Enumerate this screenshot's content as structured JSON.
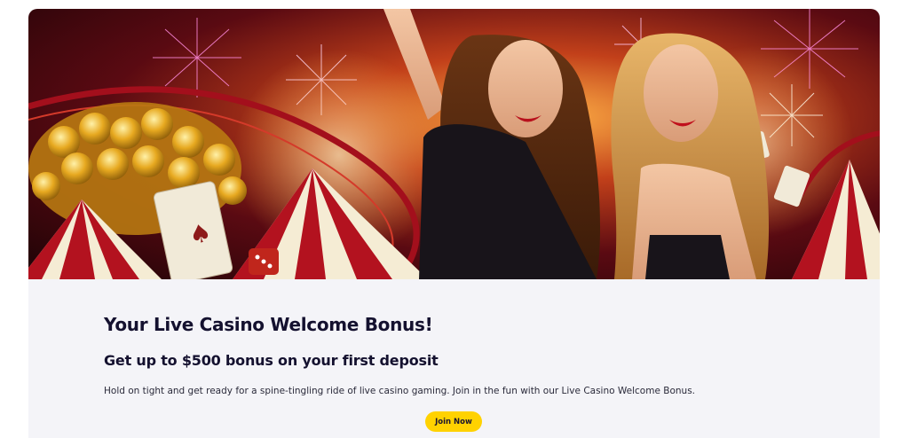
{
  "hero": {
    "image_alt": "Two women celebrating with fireworks, circus tents, gold coins and playing cards",
    "icons": [
      "fireworks-icon",
      "coins-icon",
      "circus-tent-icon",
      "playing-card-icon",
      "dice-icon"
    ]
  },
  "promo": {
    "title": "Your Live Casino Welcome Bonus!",
    "subtitle": "Get up to $500 bonus on your first deposit",
    "description": "Hold on tight and get ready for a spine-tingling ride of live casino gaming. Join in the fun with our Live Casino Welcome Bonus.",
    "cta_label": "Join Now"
  },
  "colors": {
    "page_background": "#ffffff",
    "promo_background": "#f4f4f8",
    "heading_text": "#14112f",
    "cta_background": "#ffd200",
    "hero_red": "#b3121f",
    "hero_gold": "#f6b73c"
  }
}
